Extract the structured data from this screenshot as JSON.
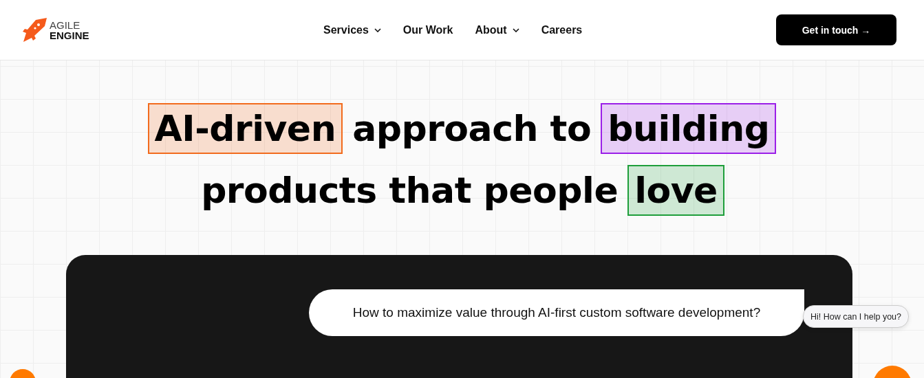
{
  "header": {
    "logo": {
      "line1": "AGILE",
      "line2": "ENGINE"
    },
    "nav": [
      {
        "label": "Services",
        "dropdown": true
      },
      {
        "label": "Our Work",
        "dropdown": false
      },
      {
        "label": "About",
        "dropdown": true
      },
      {
        "label": "Careers",
        "dropdown": false
      }
    ],
    "cta": "Get in touch →"
  },
  "headline": [
    [
      {
        "kind": "highlight",
        "text": "AI-driven",
        "color": "#f26b1d"
      },
      {
        "kind": "plain",
        "text": "approach to"
      },
      {
        "kind": "highlight",
        "text": "building",
        "color": "#9b1fe8"
      }
    ],
    [
      {
        "kind": "plain",
        "text": "products that people"
      },
      {
        "kind": "highlight",
        "text": "love",
        "color": "#1e9e3a"
      }
    ]
  ],
  "video_panel": {
    "question": "How to maximize value through AI-first custom software development?"
  },
  "chat": {
    "greeting": "Hi! How can I help you?"
  }
}
